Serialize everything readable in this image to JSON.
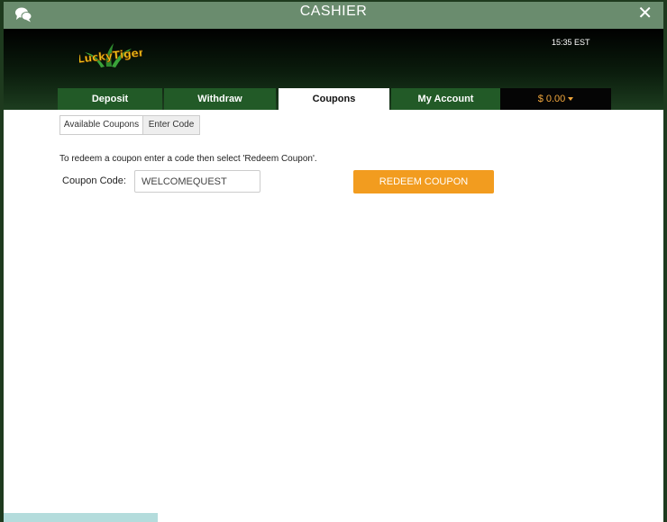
{
  "window": {
    "title": "CASHIER",
    "close_symbol": "✕",
    "chat_icon": "chat-bubbles-icon"
  },
  "header": {
    "logo_text": "LUCKY TIGER",
    "time": "15:35 EST"
  },
  "tabs": [
    {
      "label": "Deposit",
      "active": false
    },
    {
      "label": "Withdraw",
      "active": false
    },
    {
      "label": "Coupons",
      "active": true
    },
    {
      "label": "My Account",
      "active": false
    }
  ],
  "balance": {
    "label": "$ 0.00"
  },
  "subtabs": [
    {
      "label": "Available Coupons",
      "active": false
    },
    {
      "label": "Enter Code",
      "active": true
    }
  ],
  "coupon": {
    "instruction": "To redeem a coupon enter a code then select 'Redeem Coupon'.",
    "code_label": "Coupon Code:",
    "code_value": "WELCOMEQUEST",
    "redeem_label": "REDEEM COUPON"
  },
  "colors": {
    "titlebar": "#6a8c6e",
    "tab_green": "#225a27",
    "accent_orange": "#f29c1f",
    "balance_text": "#f0a63c"
  }
}
